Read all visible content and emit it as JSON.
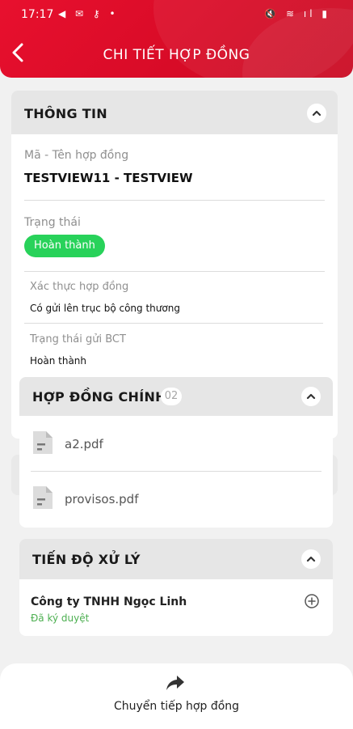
{
  "status_bar": {
    "time": "17:17",
    "left_icons": "◀ ✉ ⚷ •",
    "right_icons": "🔇 ≋ ıl ▮"
  },
  "header": {
    "title": "CHI TIẾT HỢP ĐỒNG",
    "back_icon": "chevron-left-icon"
  },
  "info": {
    "title": "THÔNG TIN",
    "contract_label": "Mã - Tên hợp đồng",
    "contract_value": "TESTVIEW11 - TESTVIEW",
    "status_label": "Trạng thái",
    "status_value": "Hoàn thành",
    "status_color": "#28d25a",
    "verify_label": "Xác thực hợp đồng",
    "verify_value": "Có gửi lên trục bộ công thương",
    "bct_label": "Trạng thái gửi BCT",
    "bct_value": "Hoàn thành"
  },
  "main_contract": {
    "title": "HỢP ĐỒNG CHÍNH",
    "count": "02",
    "files": [
      {
        "name": "a2.pdf",
        "icon": "file-icon"
      },
      {
        "name": "provisos.pdf",
        "icon": "file-icon"
      }
    ]
  },
  "progress": {
    "title": "TIẾN ĐỘ XỬ LÝ",
    "company": "Công ty TNHH Ngọc Linh",
    "company_status": "Đã ký duyệt",
    "expand_icon": "plus-circle-icon"
  },
  "footer": {
    "forward_label": "Chuyển tiếp hợp đồng",
    "forward_icon": "share-forward-icon"
  },
  "colors": {
    "brand": "#e8102e",
    "accent_green": "#28d25a",
    "approved_green": "#4caf50"
  }
}
